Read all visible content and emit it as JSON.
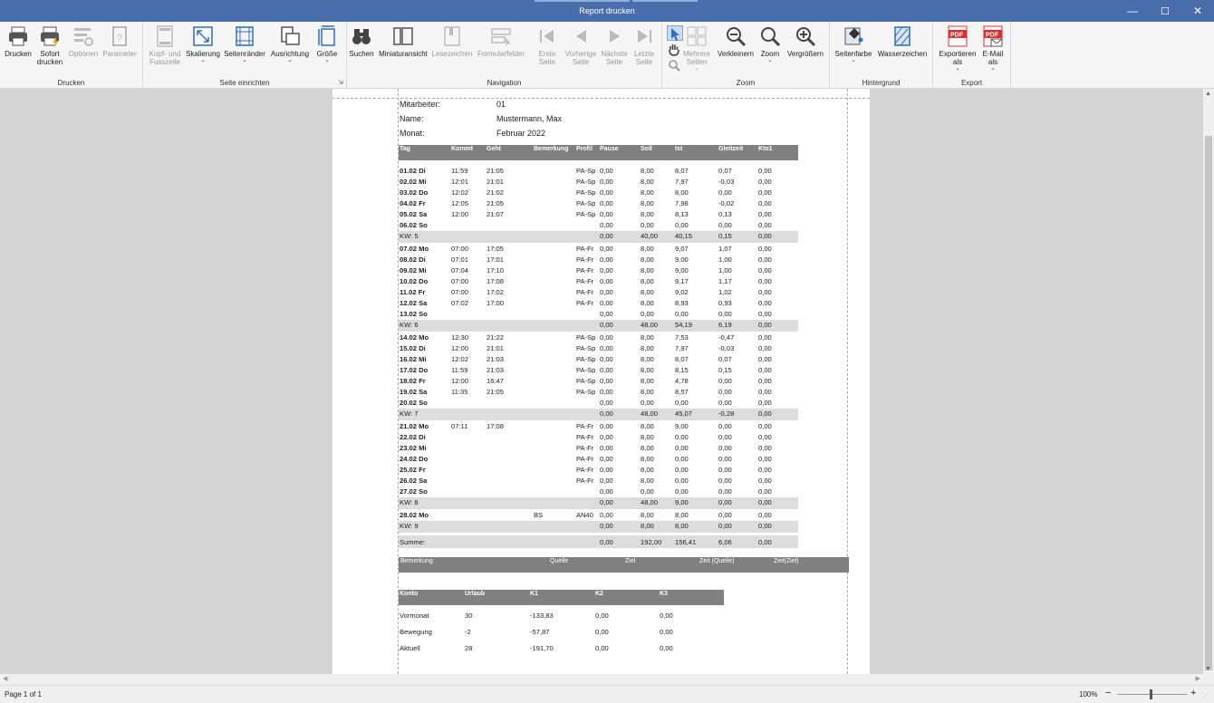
{
  "window": {
    "title": "Report drucken",
    "controls": {
      "minimize": "—",
      "maximize": "☐",
      "close": "✕"
    }
  },
  "ribbon": {
    "groups": [
      {
        "caption": "Drucken",
        "buttons": [
          {
            "id": "drucken",
            "label": "Drucken",
            "icon": "printer-icon",
            "enabled": true
          },
          {
            "id": "sofort",
            "label": "Sofort\ndrucken",
            "icon": "quick-print-icon",
            "enabled": true
          },
          {
            "id": "optionen",
            "label": "Optionen",
            "icon": "options-icon",
            "enabled": false
          },
          {
            "id": "parameter",
            "label": "Parameter",
            "icon": "parameter-icon",
            "enabled": false
          }
        ]
      },
      {
        "caption": "Seite einrichten",
        "buttons": [
          {
            "id": "kopf",
            "label": "Kopf- und\nFusszeile",
            "icon": "header-footer-icon",
            "enabled": false
          },
          {
            "id": "skalierung",
            "label": "Skalierung",
            "icon": "scale-icon",
            "enabled": true,
            "dropdown": true
          },
          {
            "id": "raender",
            "label": "Seitenränder",
            "icon": "margins-icon",
            "enabled": true,
            "dropdown": true
          },
          {
            "id": "ausrichtung",
            "label": "Ausrichtung",
            "icon": "orientation-icon",
            "enabled": true,
            "dropdown": true
          },
          {
            "id": "groesse",
            "label": "Größe",
            "icon": "page-size-icon",
            "enabled": true,
            "dropdown": true
          }
        ]
      },
      {
        "caption": "Navigation",
        "buttons": [
          {
            "id": "suchen",
            "label": "Suchen",
            "icon": "binoculars-icon",
            "enabled": true
          },
          {
            "id": "miniatur",
            "label": "Miniaturansicht",
            "icon": "thumbnails-icon",
            "enabled": true
          },
          {
            "id": "lesezeichen",
            "label": "Lesezeichen",
            "icon": "bookmark-icon",
            "enabled": false
          },
          {
            "id": "formular",
            "label": "Formularfelder",
            "icon": "form-fields-icon",
            "enabled": false
          },
          {
            "id": "erste",
            "label": "Erste\nSeite",
            "icon": "first-page-icon",
            "enabled": false
          },
          {
            "id": "vorige",
            "label": "Vorherige\nSeite",
            "icon": "previous-page-icon",
            "enabled": false
          },
          {
            "id": "naechste",
            "label": "Nächste\nSeite",
            "icon": "next-page-icon",
            "enabled": false
          },
          {
            "id": "letzte",
            "label": "Letzte\nSeite",
            "icon": "last-page-icon",
            "enabled": false
          }
        ]
      },
      {
        "caption": "Zoom",
        "buttons": [
          {
            "id": "mehrere",
            "label": "Mehrere\nSeiten",
            "icon": "multiple-pages-icon",
            "enabled": false,
            "dropdown": true
          },
          {
            "id": "verkleinern",
            "label": "Verkleinern",
            "icon": "zoom-out-icon",
            "enabled": true
          },
          {
            "id": "zoom",
            "label": "Zoom",
            "icon": "zoom-icon",
            "enabled": true,
            "dropdown": true
          },
          {
            "id": "vergroessern",
            "label": "Vergrößern",
            "icon": "zoom-in-icon",
            "enabled": true
          }
        ]
      },
      {
        "caption": "Hintergrund",
        "buttons": [
          {
            "id": "seitenfarbe",
            "label": "Seitenfarbe",
            "icon": "page-color-icon",
            "enabled": true,
            "dropdown": true
          },
          {
            "id": "wasserzeichen",
            "label": "Wasserzeichen",
            "icon": "watermark-icon",
            "enabled": true
          }
        ]
      },
      {
        "caption": "Export",
        "buttons": [
          {
            "id": "exportieren",
            "label": "Exportieren\nals",
            "icon": "pdf-export-icon",
            "enabled": true,
            "dropdown": true
          },
          {
            "id": "email",
            "label": "E-Mail\nals",
            "icon": "pdf-email-icon",
            "enabled": true,
            "dropdown": true
          }
        ]
      }
    ],
    "pdf_text": "PDF"
  },
  "report": {
    "header": [
      {
        "label": "Mitarbeiter:",
        "value": "01"
      },
      {
        "label": "Name:",
        "value": "Mustermann, Max"
      },
      {
        "label": "Monat:",
        "value": "Februar 2022"
      }
    ],
    "columns": [
      "Tag",
      "Kommt",
      "Geht",
      "Bemerkung",
      "Profil",
      "Pause",
      "Soll",
      "Ist",
      "Gleitzeit",
      "Kto1"
    ],
    "rows": [
      [
        "01.02 Di",
        "11:59",
        "21:05",
        "",
        "PA-Sp",
        "0,00",
        "8,00",
        "8,07",
        "0,07",
        "0,00"
      ],
      [
        "02.02 Mi",
        "12:01",
        "21:01",
        "",
        "PA-Sp",
        "0,00",
        "8,00",
        "7,97",
        "-0,03",
        "0,00"
      ],
      [
        "03.02 Do",
        "12:02",
        "21:02",
        "",
        "PA-Sp",
        "0,00",
        "8,00",
        "8,00",
        "0,00",
        "0,00"
      ],
      [
        "04.02 Fr",
        "12:05",
        "21:05",
        "",
        "PA-Sp",
        "0,00",
        "8,00",
        "7,98",
        "-0,02",
        "0,00"
      ],
      [
        "05.02 Sa",
        "12:00",
        "21:07",
        "",
        "PA-Sp",
        "0,00",
        "8,00",
        "8,13",
        "0,13",
        "0,00"
      ],
      [
        "06.02 So",
        "",
        "",
        "",
        "",
        "0,00",
        "0,00",
        "0,00",
        "0,00",
        "0,00"
      ],
      [
        "KW: 5",
        "",
        "",
        "",
        "",
        "0,00",
        "40,00",
        "40,15",
        "0,15",
        "0,00"
      ],
      [
        "07.02 Mo",
        "07:00",
        "17:05",
        "",
        "PA-Fr",
        "0,00",
        "8,00",
        "9,07",
        "1,07",
        "0,00"
      ],
      [
        "08.02 Di",
        "07:01",
        "17:01",
        "",
        "PA-Fr",
        "0,00",
        "8,00",
        "9,00",
        "1,00",
        "0,00"
      ],
      [
        "09.02 Mi",
        "07:04",
        "17:10",
        "",
        "PA-Fr",
        "0,00",
        "8,00",
        "9,00",
        "1,00",
        "0,00"
      ],
      [
        "10.02 Do",
        "07:00",
        "17:08",
        "",
        "PA-Fr",
        "0,00",
        "8,00",
        "9,17",
        "1,17",
        "0,00"
      ],
      [
        "11.02 Fr",
        "07:00",
        "17:02",
        "",
        "PA-Fr",
        "0,00",
        "8,00",
        "9,02",
        "1,02",
        "0,00"
      ],
      [
        "12.02 Sa",
        "07:02",
        "17:00",
        "",
        "PA-Fr",
        "0,00",
        "8,00",
        "8,93",
        "0,93",
        "0,00"
      ],
      [
        "13.02 So",
        "",
        "",
        "",
        "",
        "0,00",
        "0,00",
        "0,00",
        "0,00",
        "0,00"
      ],
      [
        "KW: 6",
        "",
        "",
        "",
        "",
        "0,00",
        "48,00",
        "54,19",
        "6,19",
        "0,00"
      ],
      [
        "14.02 Mo",
        "12:30",
        "21:22",
        "",
        "PA-Sp",
        "0,00",
        "8,00",
        "7,53",
        "-0,47",
        "0,00"
      ],
      [
        "15.02 Di",
        "12:00",
        "21:01",
        "",
        "PA-Sp",
        "0,00",
        "8,00",
        "7,97",
        "-0,03",
        "0,00"
      ],
      [
        "16.02 Mi",
        "12:02",
        "21:03",
        "",
        "PA-Sp",
        "0,00",
        "8,00",
        "8,07",
        "0,07",
        "0,00"
      ],
      [
        "17.02 Do",
        "11:59",
        "21:03",
        "",
        "PA-Sp",
        "0,00",
        "8,00",
        "8,15",
        "0,15",
        "0,00"
      ],
      [
        "18.02 Fr",
        "12:00",
        "16:47",
        "",
        "PA-Sp",
        "0,00",
        "8,00",
        "4,78",
        "0,00",
        "0,00"
      ],
      [
        "19.02 Sa",
        "11:35",
        "21:05",
        "",
        "PA-Sp",
        "0,00",
        "8,00",
        "8,57",
        "0,00",
        "0,00"
      ],
      [
        "20.02 So",
        "",
        "",
        "",
        "",
        "0,00",
        "0,00",
        "0,00",
        "0,00",
        "0,00"
      ],
      [
        "KW: 7",
        "",
        "",
        "",
        "",
        "0,00",
        "48,00",
        "45,07",
        "-0,28",
        "0,00"
      ],
      [
        "21.02 Mo",
        "07:11",
        "17:08",
        "",
        "PA-Fr",
        "0,00",
        "8,00",
        "9,00",
        "0,00",
        "0,00"
      ],
      [
        "22.02 Di",
        "",
        "",
        "",
        "PA-Fr",
        "0,00",
        "8,00",
        "0,00",
        "0,00",
        "0,00"
      ],
      [
        "23.02 Mi",
        "",
        "",
        "",
        "PA-Fr",
        "0,00",
        "8,00",
        "0,00",
        "0,00",
        "0,00"
      ],
      [
        "24.02 Do",
        "",
        "",
        "",
        "PA-Fr",
        "0,00",
        "8,00",
        "0,00",
        "0,00",
        "0,00"
      ],
      [
        "25.02 Fr",
        "",
        "",
        "",
        "PA-Fr",
        "0,00",
        "8,00",
        "0,00",
        "0,00",
        "0,00"
      ],
      [
        "26.02 Sa",
        "",
        "",
        "",
        "PA-Fr",
        "0,00",
        "8,00",
        "0,00",
        "0,00",
        "0,00"
      ],
      [
        "27.02 So",
        "",
        "",
        "",
        "",
        "0,00",
        "0,00",
        "0,00",
        "0,00",
        "0,00"
      ],
      [
        "KW: 8",
        "",
        "",
        "",
        "",
        "0,00",
        "48,00",
        "9,00",
        "0,00",
        "0,00"
      ],
      [
        "28.02 Mo",
        "",
        "",
        "BS",
        "AN40",
        "0,00",
        "8,00",
        "8,00",
        "0,00",
        "0,00"
      ],
      [
        "KW: 9",
        "",
        "",
        "",
        "",
        "0,00",
        "8,00",
        "8,00",
        "0,00",
        "0,00"
      ],
      [
        "Summe:",
        "",
        "",
        "",
        "",
        "0,00",
        "192,00",
        "156,41",
        "6,06",
        "0,00"
      ]
    ],
    "remarks_columns": [
      "Bemerkung",
      "Quelle",
      "Ziel",
      "Zeit (Quelle)",
      "Zeit(Ziel)"
    ],
    "account_columns": [
      "Konto",
      "Urlaub",
      "K1",
      "K2",
      "K3"
    ],
    "account_rows": [
      [
        "Vormonat",
        "30",
        "-133,83",
        "0,00",
        "0,00"
      ],
      [
        "Bewegung",
        "-2",
        "-57,87",
        "0,00",
        "0,00"
      ],
      [
        "Aktuell",
        "28",
        "-191,70",
        "0,00",
        "0,00"
      ]
    ]
  },
  "status": {
    "page_info": "Page 1 of 1",
    "zoom": "100%",
    "zoom_minus": "−",
    "zoom_plus": "+"
  },
  "colors": {
    "titlebar": "#4a6eab",
    "header_fill": "#808080",
    "subtotal_fill": "#dcdcdc",
    "pdf_red": "#d8302e",
    "icon_blue": "#2f6fbf"
  }
}
